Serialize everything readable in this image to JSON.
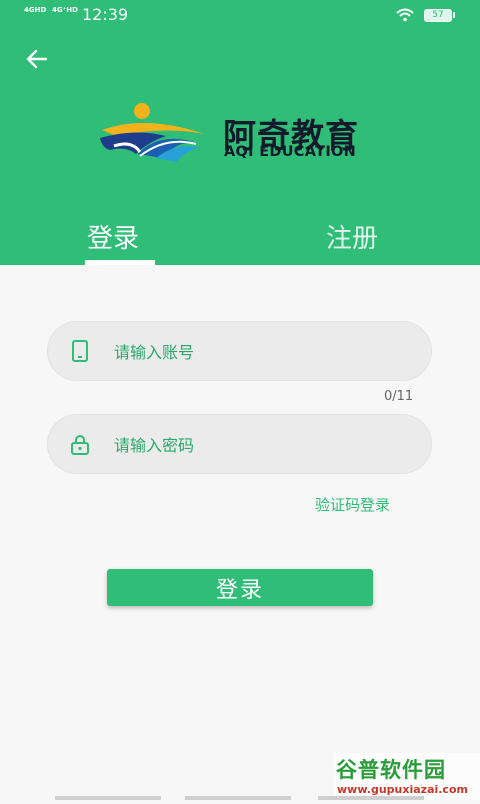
{
  "status_bar": {
    "network_1": "4GHD",
    "network_2": "4G⁺HD",
    "time": "12:39",
    "battery": "57"
  },
  "header": {
    "brand_cn": "阿奇教育",
    "brand_en": "AQI EDUCATION",
    "tabs": [
      {
        "label": "登录",
        "active": true
      },
      {
        "label": "注册",
        "active": false
      }
    ]
  },
  "form": {
    "account_placeholder": "请输入账号",
    "account_counter": "0/11",
    "password_placeholder": "请输入密码",
    "code_login_label": "验证码登录",
    "login_button": "登录"
  },
  "watermark": {
    "text": "谷普软件园",
    "url": "www.gupuxiazai.com"
  },
  "colors": {
    "brand_green": "#2fbd77",
    "logo_navy": "#121a2b",
    "logo_yellow": "#f2b21c"
  }
}
